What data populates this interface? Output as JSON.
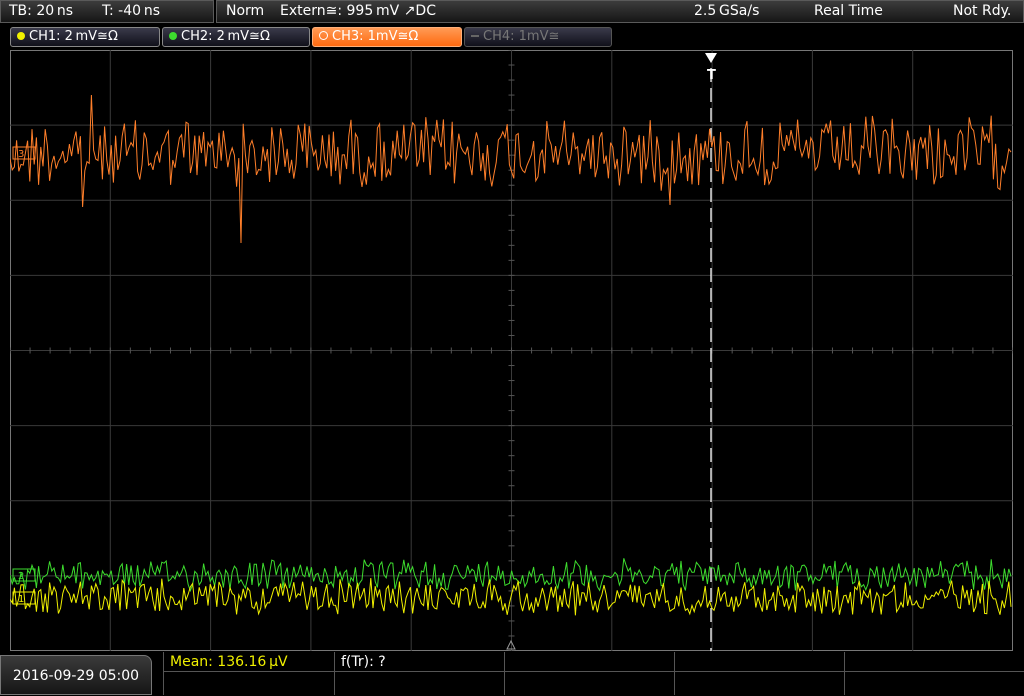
{
  "header": {
    "timebase": "TB: 20 ns",
    "trigger_offset": "T: -40 ns",
    "trigger_mode": "Norm",
    "trigger_source": "Extern≅: 995 mV ↗DC",
    "sample_rate": "2.5 GSa/s",
    "acq_mode": "Real Time",
    "status": "Not Rdy."
  },
  "channels": [
    {
      "label": "CH1: 2 mV≅Ω",
      "color": "#f0f000",
      "active": true
    },
    {
      "label": "CH2: 2 mV≅Ω",
      "color": "#3ddc2e",
      "active": true
    },
    {
      "label": "CH3: 1mV≅Ω",
      "color": "#ff7f2a",
      "active": true,
      "selected": true
    },
    {
      "label": "CH4: 1mV≅",
      "color": "#7a7a7a",
      "active": false
    }
  ],
  "markers": {
    "trigger": "T",
    "ch3": "3",
    "ch2": "2",
    "ch1": "1"
  },
  "footer": {
    "datetime": "2016-09-29 05:00",
    "measurement_1": "Mean: 136.16 µV",
    "measurement_2": "f(Tr): ?"
  },
  "colors": {
    "ch1": "#f0f000",
    "ch2": "#3ddc2e",
    "ch3": "#ff7f2a",
    "grid": "#3a3a3a",
    "background": "#000000"
  }
}
